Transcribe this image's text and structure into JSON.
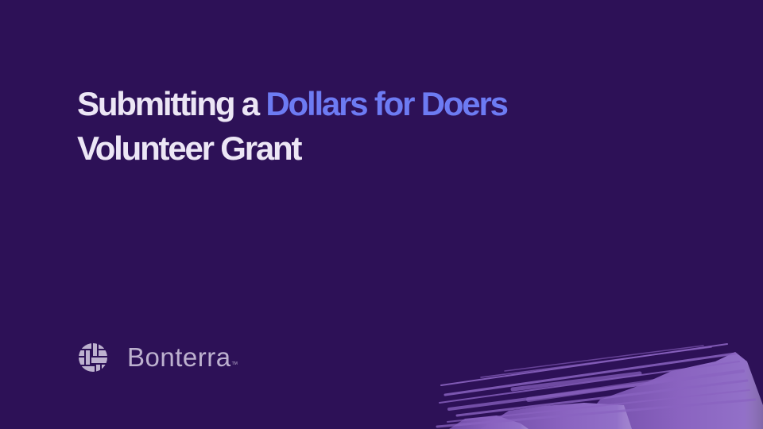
{
  "title": {
    "line1_prefix": "Submitting a",
    "line1_accent": "Dollars for Doers",
    "line2": "Volunteer Grant"
  },
  "brand": {
    "logo_icon": "woven-globe-icon",
    "name": "Bonterra",
    "trademark": "TM"
  },
  "decoration": {
    "brush_icon": "paint-brush-stroke"
  },
  "colors": {
    "background": "#2d1157",
    "title_text": "#ece6f5",
    "accent": "#6d7bf3",
    "brand_text": "#bdb1cf",
    "brush": "#8a63c0"
  }
}
